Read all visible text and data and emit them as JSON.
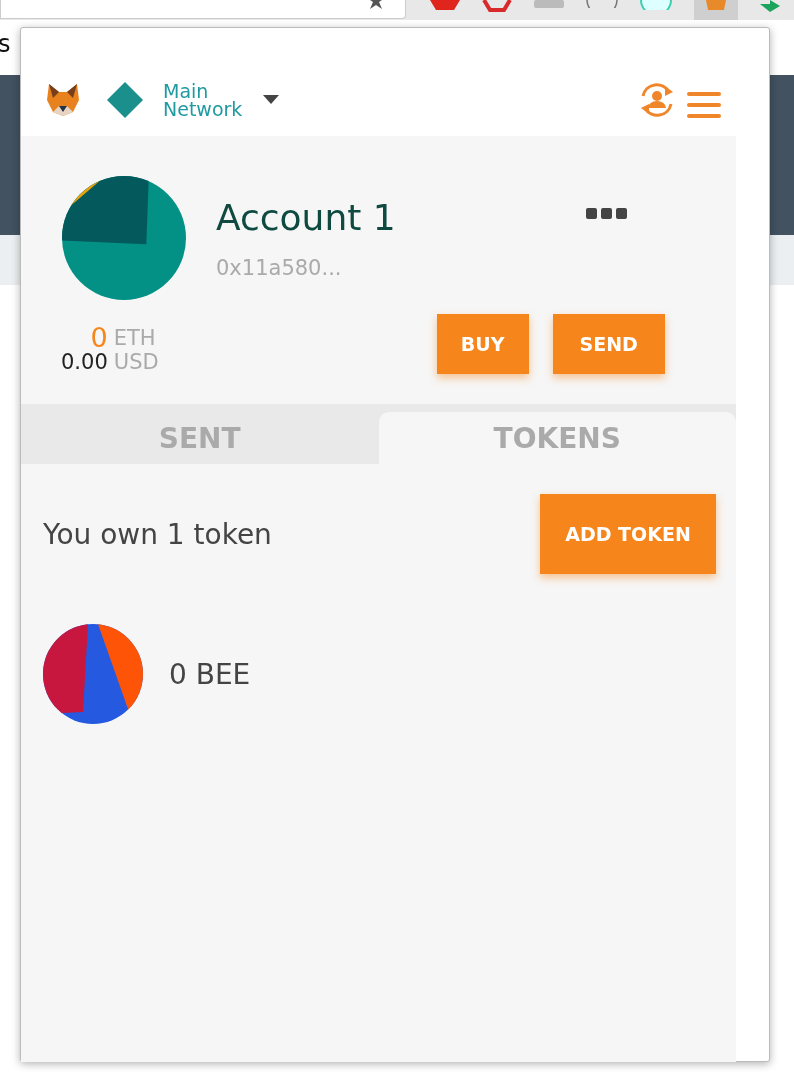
{
  "browser": {
    "page_text": "s"
  },
  "header": {
    "network": "Main Network"
  },
  "account": {
    "name": "Account 1",
    "address": "0x11a580...",
    "balance": {
      "amount": "0",
      "unit": "ETH",
      "fiat_amount": "0.00",
      "fiat_unit": "USD"
    }
  },
  "buttons": [
    "BUY",
    "SEND"
  ],
  "tabs": [
    {
      "label": "SENT",
      "selected": false
    },
    {
      "label": "TOKENS",
      "selected": true
    }
  ],
  "tokens": {
    "summary": "You own 1 token",
    "add_button": "ADD TOKEN",
    "items": [
      {
        "label": "0 BEE"
      }
    ]
  }
}
